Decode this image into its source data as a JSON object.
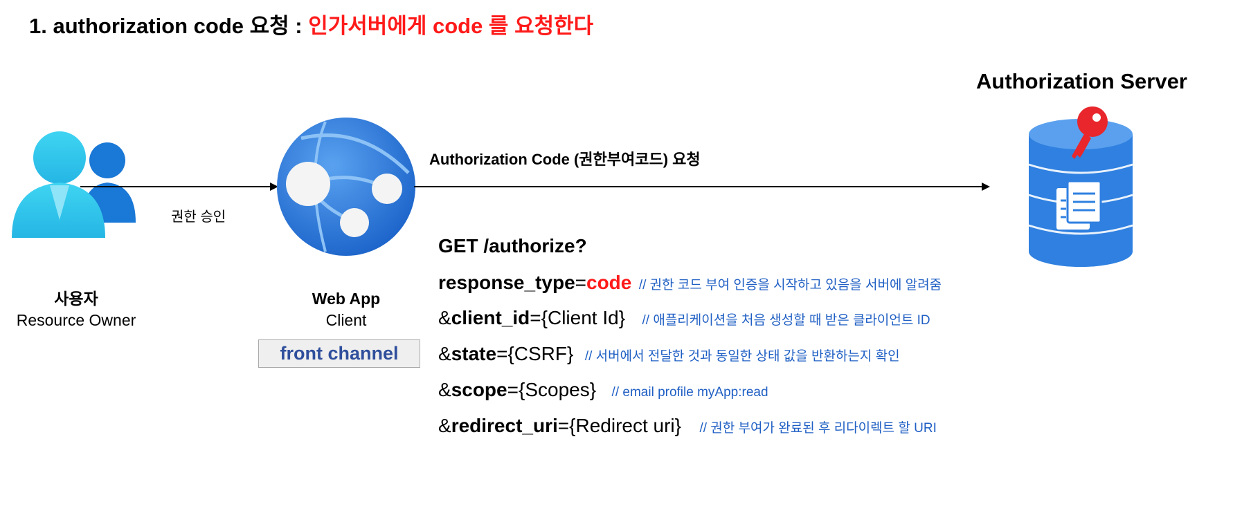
{
  "header": {
    "title_prefix": "1. authorization code 요청 : ",
    "title_highlight": "인가서버에게 code 를 요청한다"
  },
  "actors": {
    "user": {
      "name": "사용자",
      "role": "Resource Owner"
    },
    "client": {
      "name": "Web App",
      "role": "Client",
      "channel": "front channel"
    },
    "server": {
      "name": "Authorization Server"
    }
  },
  "arrows": {
    "grant": "권한 승인",
    "request": "Authorization Code (권한부여코드) 요청"
  },
  "request": {
    "line1": "GET /authorize?",
    "params": [
      {
        "prefix": "",
        "key": "response_type",
        "eq": "=",
        "value": "code",
        "comment": "// 권한 코드 부여 인증을 시작하고 있음을 서버에 알려줌"
      },
      {
        "prefix": "&",
        "key": "client_id",
        "eq": "=",
        "value": "{Client Id}",
        "comment": "// 애플리케이션을 처음 생성할 때 받은 클라이언트 ID"
      },
      {
        "prefix": "&",
        "key": "state",
        "eq": "=",
        "value": "{CSRF}",
        "comment": "// 서버에서 전달한 것과 동일한 상태 값을 반환하는지 확인"
      },
      {
        "prefix": "&",
        "key": "scope",
        "eq": "=",
        "value": "{Scopes}",
        "comment": "// email profile myApp:read"
      },
      {
        "prefix": "&",
        "key": "redirect_uri",
        "eq": "=",
        "value": "{Redirect uri}",
        "comment": "// 권한 부여가 완료된 후 리다이렉트 할 URI"
      }
    ]
  },
  "colors": {
    "accent_red": "#ff1a1a",
    "comment_blue": "#1f5fc4",
    "globe_blue": "#2f7be0",
    "db_blue": "#2f80e0",
    "key_red": "#e8262b",
    "user_cyan": "#2ec6ea",
    "user_blue": "#1a78d6"
  },
  "icons": [
    "users-icon",
    "web-app-globe-icon",
    "database-key-icon",
    "document-icon",
    "key-icon"
  ]
}
